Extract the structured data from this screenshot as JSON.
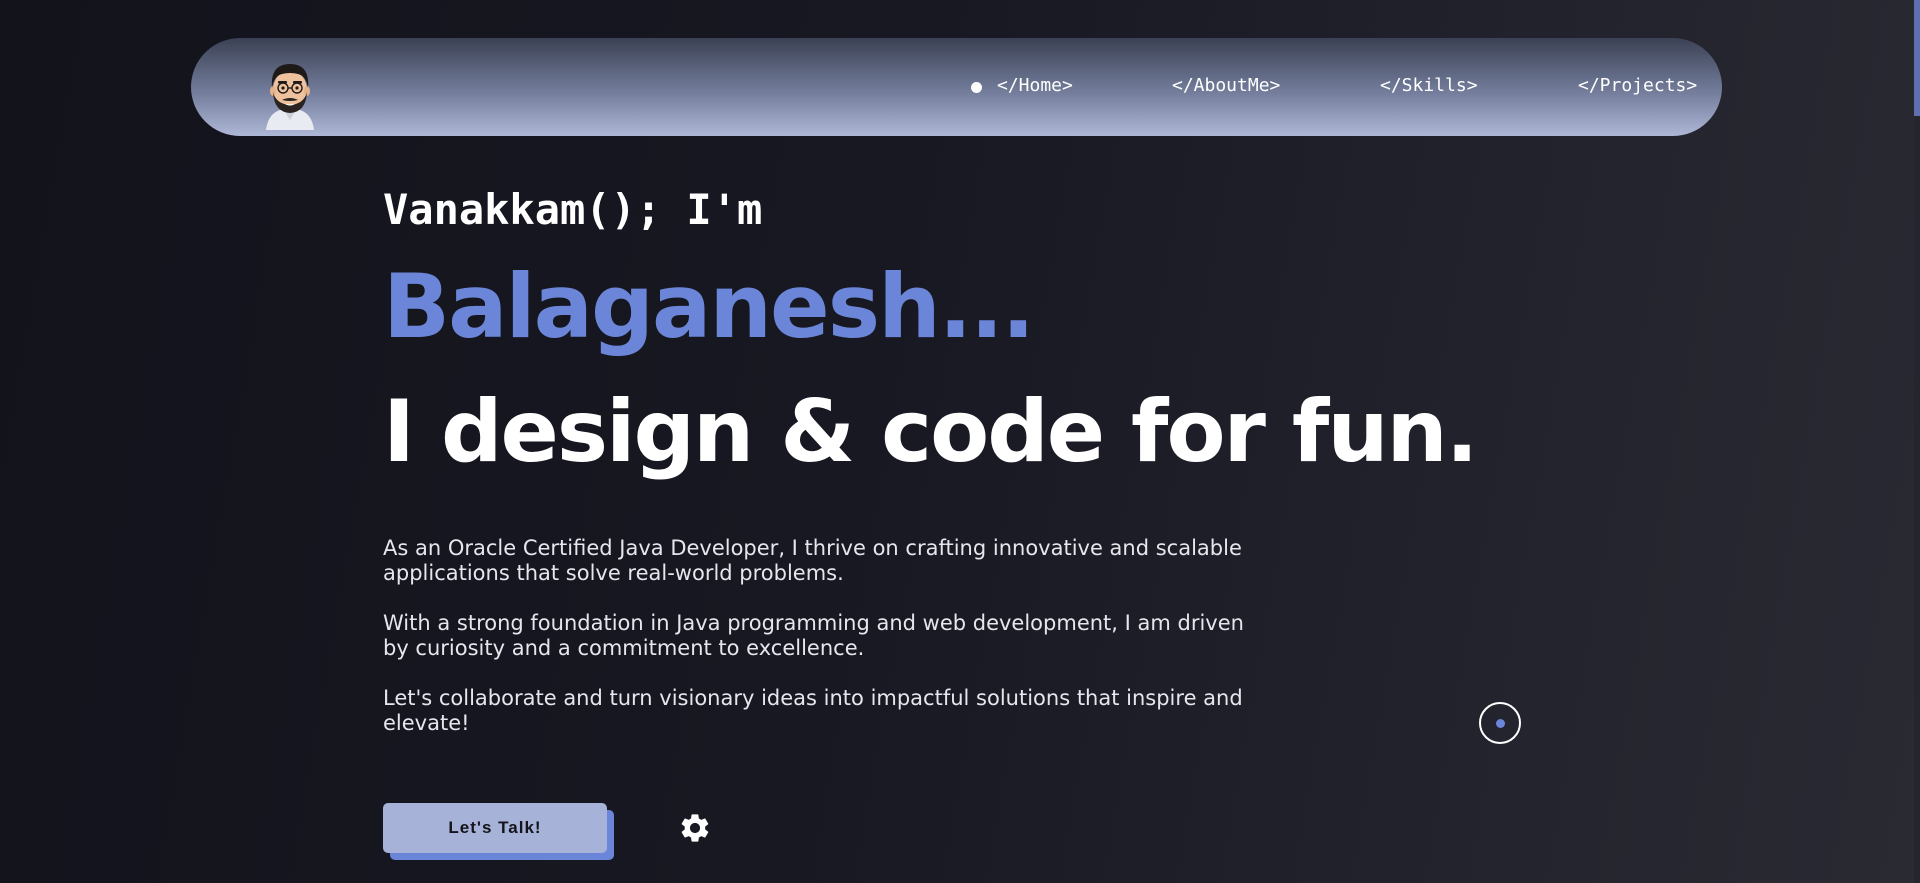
{
  "nav": {
    "items": [
      {
        "label": "</Home>"
      },
      {
        "label": "</AboutMe>"
      },
      {
        "label": "</Skills>"
      },
      {
        "label": "</Projects>"
      }
    ],
    "active_index": 0
  },
  "hero": {
    "greeting": "Vanakkam(); I'm",
    "name": "Balaganesh...",
    "tagline": "I design & code for fun.",
    "paragraphs": [
      "As an Oracle Certified Java Developer, I thrive on crafting innovative and scalable applications that solve real-world problems.",
      "With a strong foundation in Java programming and web development, I am driven by curiosity and a commitment to excellence.",
      "Let's collaborate and turn visionary ideas into impactful solutions that inspire and elevate!"
    ],
    "cta_label": "Let's Talk!"
  },
  "icons": {
    "avatar": "avatar-icon",
    "settings": "gear-icon",
    "cursor": "cursor-ring-icon"
  },
  "colors": {
    "accent": "#6b86d8",
    "background": "#15151e",
    "button": "#a7b2d8"
  }
}
